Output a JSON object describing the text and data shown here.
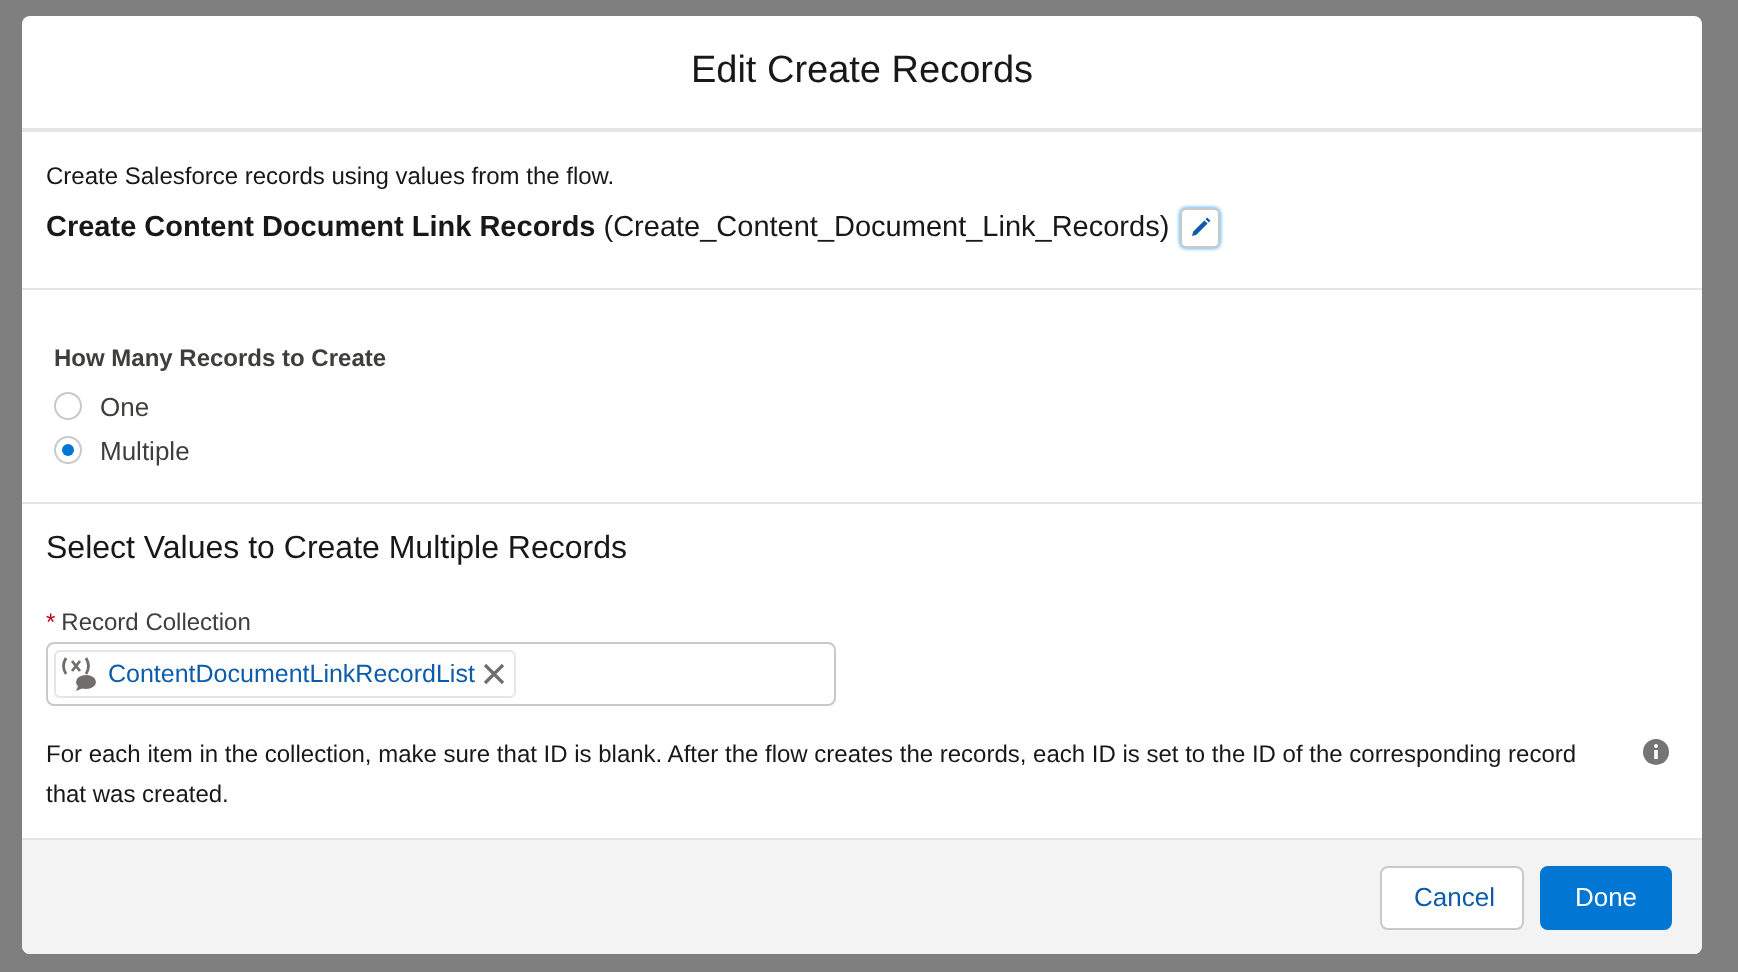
{
  "modal": {
    "title": "Edit Create Records",
    "description": "Create Salesforce records using values from the flow.",
    "element_label": "Create Content Document Link Records",
    "element_api_name": "(Create_Content_Document_Link_Records)",
    "how_many": {
      "label": "How Many Records to Create",
      "options": [
        {
          "label": "One",
          "selected": false
        },
        {
          "label": "Multiple",
          "selected": true
        }
      ]
    },
    "section_title": "Select Values to Create Multiple Records",
    "record_collection": {
      "label": "Record Collection",
      "required_mark": "*",
      "pill": "ContentDocumentLinkRecordList"
    },
    "help_text": "For each item in the collection, make sure that ID is blank. After the flow creates the records, each ID is set to the ID of the corresponding record that was created.",
    "buttons": [
      {
        "label": "Cancel",
        "kind": "neutral"
      },
      {
        "label": "Done",
        "kind": "brand"
      }
    ]
  }
}
